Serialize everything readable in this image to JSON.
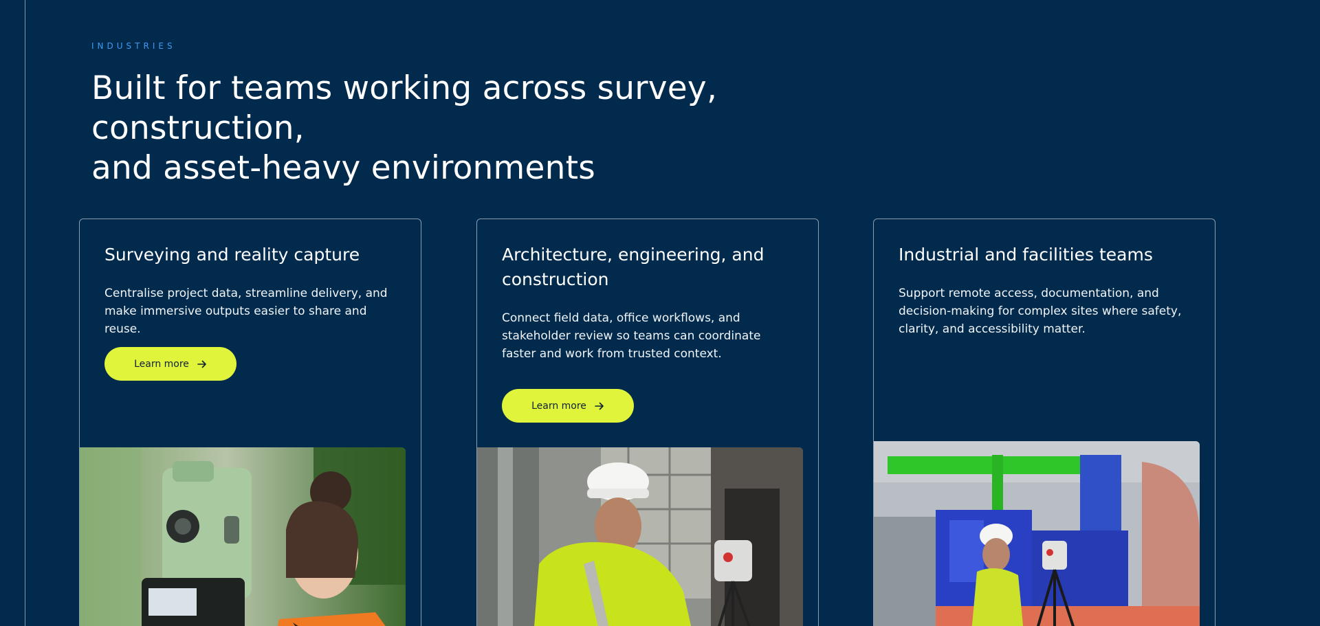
{
  "section": {
    "eyebrow": "INDUSTRIES",
    "title_line1": "Built for teams working across survey, construction,",
    "title_line2": "and asset-heavy environments"
  },
  "cards": [
    {
      "title": "Surveying and reality capture",
      "body": "Centralise project data, streamline delivery, and make immersive outputs easier to share and reuse.",
      "cta": "Learn more",
      "photo_icon": "total-station-surveyor-photo"
    },
    {
      "title": "Architecture, engineering, and construction",
      "body": "Connect field data, office workflows, and stakeholder review so teams can coordinate faster and work from trusted context.",
      "cta": "Learn more",
      "photo_icon": "construction-worker-scanner-photo"
    },
    {
      "title": "Industrial and facilities teams",
      "body": "Support remote access, documentation, and decision-making for complex sites where safety, clarity, and accessibility matter.",
      "photo_icon": "industrial-plant-scanner-photo"
    }
  ],
  "colors": {
    "background": "#022a4d",
    "accent_button": "#e0f43c",
    "eyebrow": "#3f9bf0",
    "card_border": "#8d9db0"
  },
  "icons": {
    "button_arrow": "arrow-right-icon"
  }
}
